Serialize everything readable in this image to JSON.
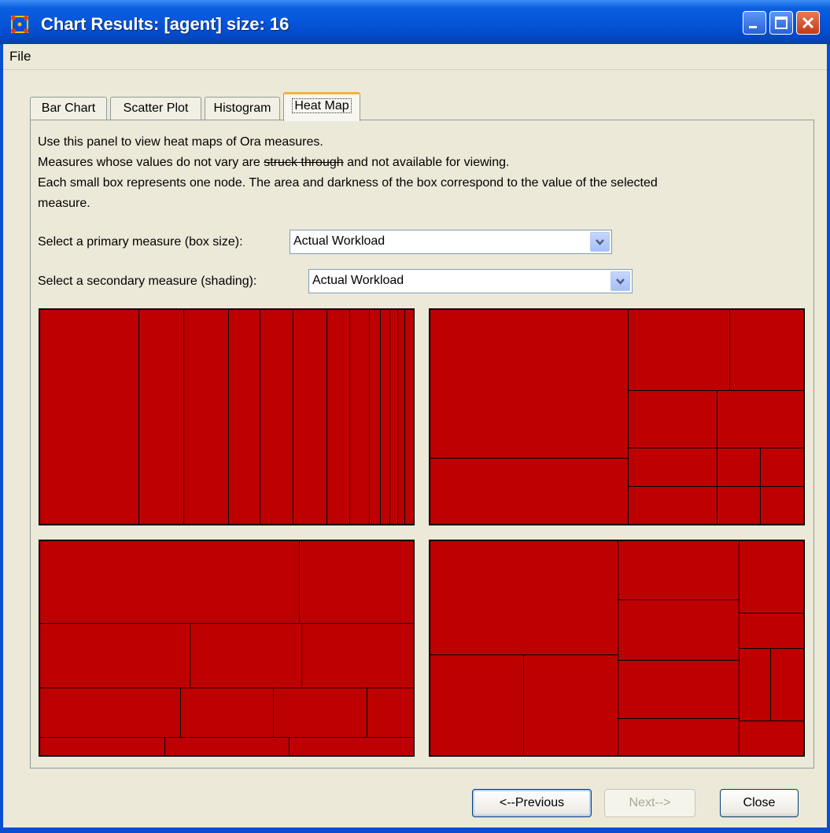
{
  "window": {
    "title": "Chart Results: [agent] size: 16",
    "controls": [
      "minimize-icon",
      "maximize-icon",
      "close-icon"
    ]
  },
  "menu": {
    "file": "File"
  },
  "tabs": [
    {
      "label": "Bar Chart",
      "active": false
    },
    {
      "label": "Scatter Plot",
      "active": false
    },
    {
      "label": "Histogram",
      "active": false
    },
    {
      "label": "Heat Map",
      "active": true
    }
  ],
  "panel": {
    "line1": "Use this panel to view heat maps of Ora measures.",
    "line2_pre": "Measures whose values do not vary are ",
    "line2_strike": "struck through",
    "line2_post": " and not available for viewing.",
    "line3": "Each small box represents one node. The area and darkness of the box correspond to the value of the selected",
    "line4": "measure.",
    "primary_label": "Select a primary measure (box size):",
    "primary_value": "Actual Workload",
    "secondary_label": "Select a secondary measure (shading):",
    "secondary_value": "Actual Workload"
  },
  "heatmap": {
    "fill_color": "#bd0000",
    "border_color": "#000000",
    "panel_count": 4
  },
  "buttons": {
    "previous": "<--Previous",
    "next": "Next-->",
    "close": "Close"
  }
}
